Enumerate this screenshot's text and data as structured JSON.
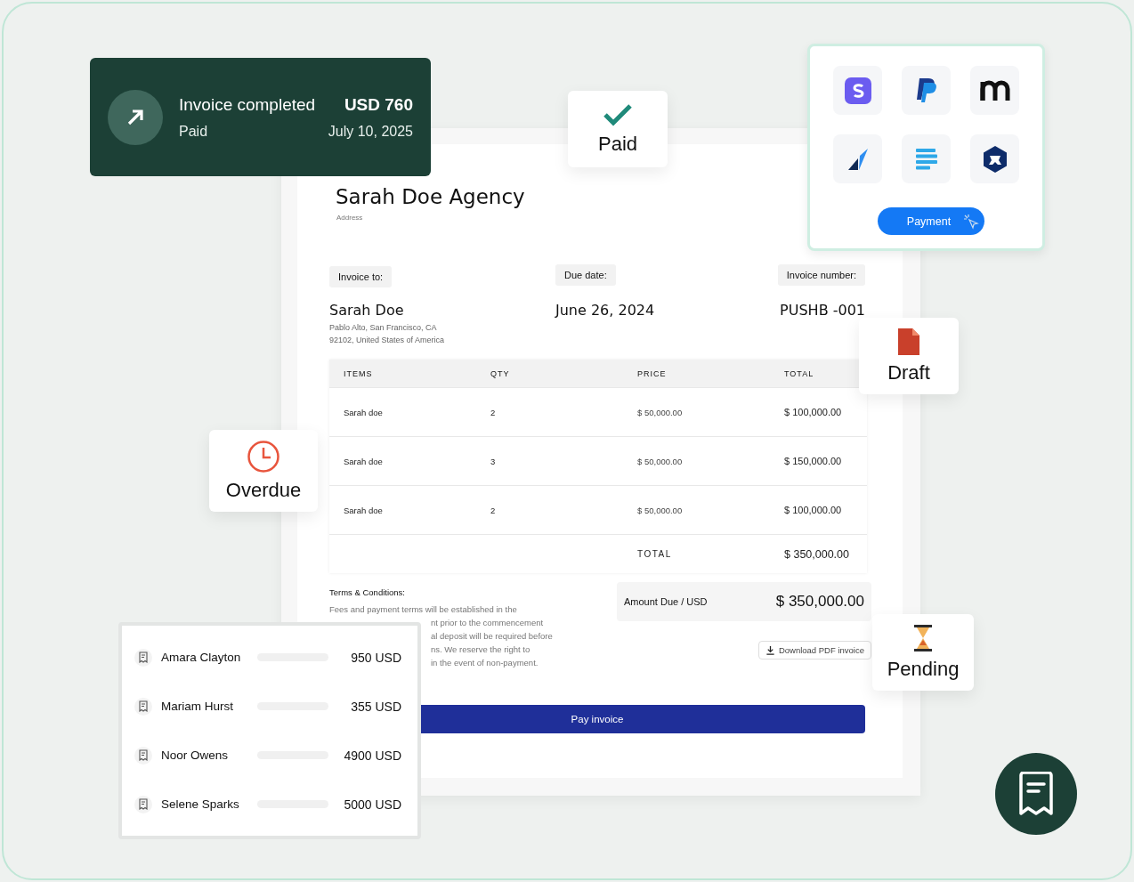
{
  "notification": {
    "title": "Invoice completed",
    "amount": "USD 760",
    "status": "Paid",
    "date": "July 10, 2025"
  },
  "badges": [
    {
      "kind": "paid",
      "label": "Paid"
    },
    {
      "kind": "draft",
      "label": "Draft"
    },
    {
      "kind": "overdue",
      "label": "Overdue"
    },
    {
      "kind": "pending",
      "label": "Pending"
    }
  ],
  "payment_card": {
    "button": "Payment"
  },
  "invoice": {
    "company": "Sarah Doe Agency",
    "address_label": "Address",
    "fields": [
      {
        "label": "Invoice to:",
        "value": "Sarah Doe"
      },
      {
        "label": "Due date:",
        "value": "June 26, 2024"
      },
      {
        "label": "Invoice number:",
        "value": "PUSHB -001"
      }
    ],
    "recipient_address": [
      "Pablo Alto, San Francisco, CA",
      "92102, United States of America"
    ],
    "table": {
      "columns": [
        "ITEMS",
        "QTY",
        "PRICE",
        "TOTAL"
      ],
      "rows": [
        [
          "Sarah doe",
          "2",
          "$ 50,000.00",
          "$ 100,000.00"
        ],
        [
          "Sarah doe",
          "3",
          "$ 50,000.00",
          "$ 150,000.00"
        ],
        [
          "Sarah doe",
          "2",
          "$ 50,000.00",
          "$ 100,000.00"
        ]
      ],
      "total_label": "TOTAL",
      "total_value": "$ 350,000.00"
    },
    "terms_title": "Terms & Conditions:",
    "terms_lines": [
      "Fees and payment terms will be established in the",
      "nt prior to the commencement",
      "al deposit will be required before",
      "ns. We reserve the right to",
      "in the event of non-payment."
    ],
    "amount_due_label": "Amount Due / USD",
    "amount_due_value": "$ 350,000.00",
    "download_button": "Download PDF invoice",
    "pay_button": "Pay invoice"
  },
  "customers": [
    {
      "name": "Amara Clayton",
      "amount": "950 USD"
    },
    {
      "name": "Mariam Hurst",
      "amount": "355 USD"
    },
    {
      "name": "Noor Owens",
      "amount": "4900 USD"
    },
    {
      "name": "Selene Sparks",
      "amount": "5000 USD"
    }
  ]
}
